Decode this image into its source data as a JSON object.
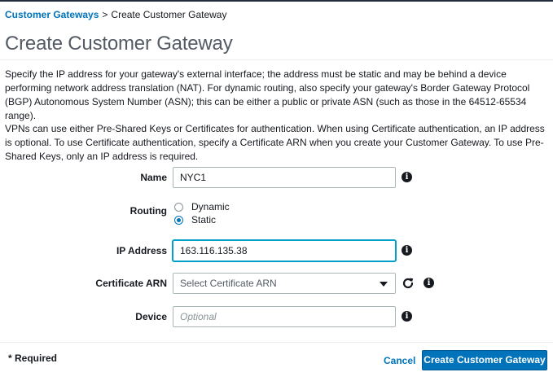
{
  "breadcrumb": {
    "parent": "Customer Gateways",
    "separator": ">",
    "current": "Create Customer Gateway"
  },
  "page_title": "Create Customer Gateway",
  "description": {
    "paragraph1": "Specify the IP address for your gateway's external interface; the address must be static and may be behind a device performing network address translation (NAT). For dynamic routing, also specify your gateway's Border Gateway Protocol (BGP) Autonomous System Number (ASN); this can be either a public or private ASN (such as those in the 64512-65534 range).",
    "paragraph2": "VPNs can use either Pre-Shared Keys or Certificates for authentication. When using Certificate authentication, an IP address is optional. To use Certificate authentication, specify a Certificate ARN when you create your Customer Gateway. To use Pre-Shared Keys, only an IP address is required."
  },
  "form": {
    "name": {
      "label": "Name",
      "value": "NYC1"
    },
    "routing": {
      "label": "Routing",
      "options": [
        "Dynamic",
        "Static"
      ],
      "selected": "Static"
    },
    "ip_address": {
      "label": "IP Address",
      "value": "163.116.135.38"
    },
    "certificate_arn": {
      "label": "Certificate ARN",
      "selected": "Select Certificate ARN"
    },
    "device": {
      "label": "Device",
      "value": "",
      "placeholder": "Optional"
    }
  },
  "info_glyph": "i",
  "footer": {
    "required_note": "* Required",
    "cancel_label": "Cancel",
    "submit_label": "Create Customer Gateway"
  },
  "colors": {
    "link": "#0073bb",
    "primary_button": "#0073bb",
    "focus_ring": "#00a1c9",
    "title": "#545b64"
  }
}
